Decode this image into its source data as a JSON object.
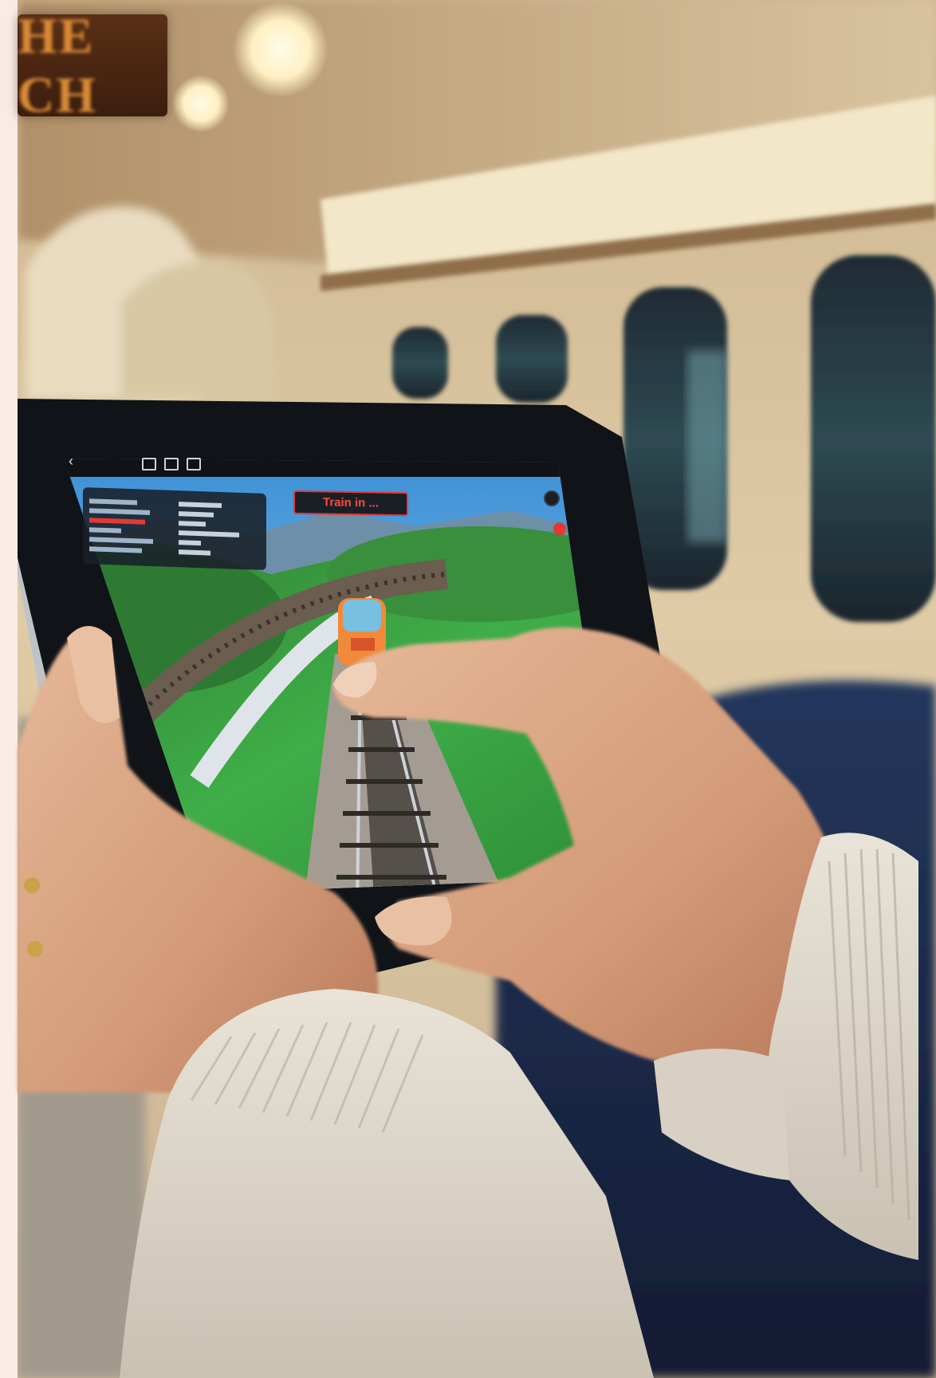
{
  "scene": {
    "background_sign_text": "HE CH",
    "colors": {
      "wall": "#e5d4b0",
      "ceiling_light": "#fff6d8",
      "seat": "#1c2a4a",
      "sweater": "#ddd6c8",
      "skin": "#d9a07e",
      "tablet_frame": "#111418",
      "grass": "#3ca646",
      "sky": "#4f9bd8",
      "ui_accent": "#e53935"
    }
  },
  "tablet_ui": {
    "back_icon": "chevron-left-icon",
    "top_icons": [
      "panel-icon",
      "panel-icon",
      "panel-icon"
    ],
    "status_icons": [
      "settings-icon",
      "alert-icon"
    ],
    "banner_text": "Train in ...",
    "menu_left_rows": 6,
    "menu_right_rows": 6
  }
}
